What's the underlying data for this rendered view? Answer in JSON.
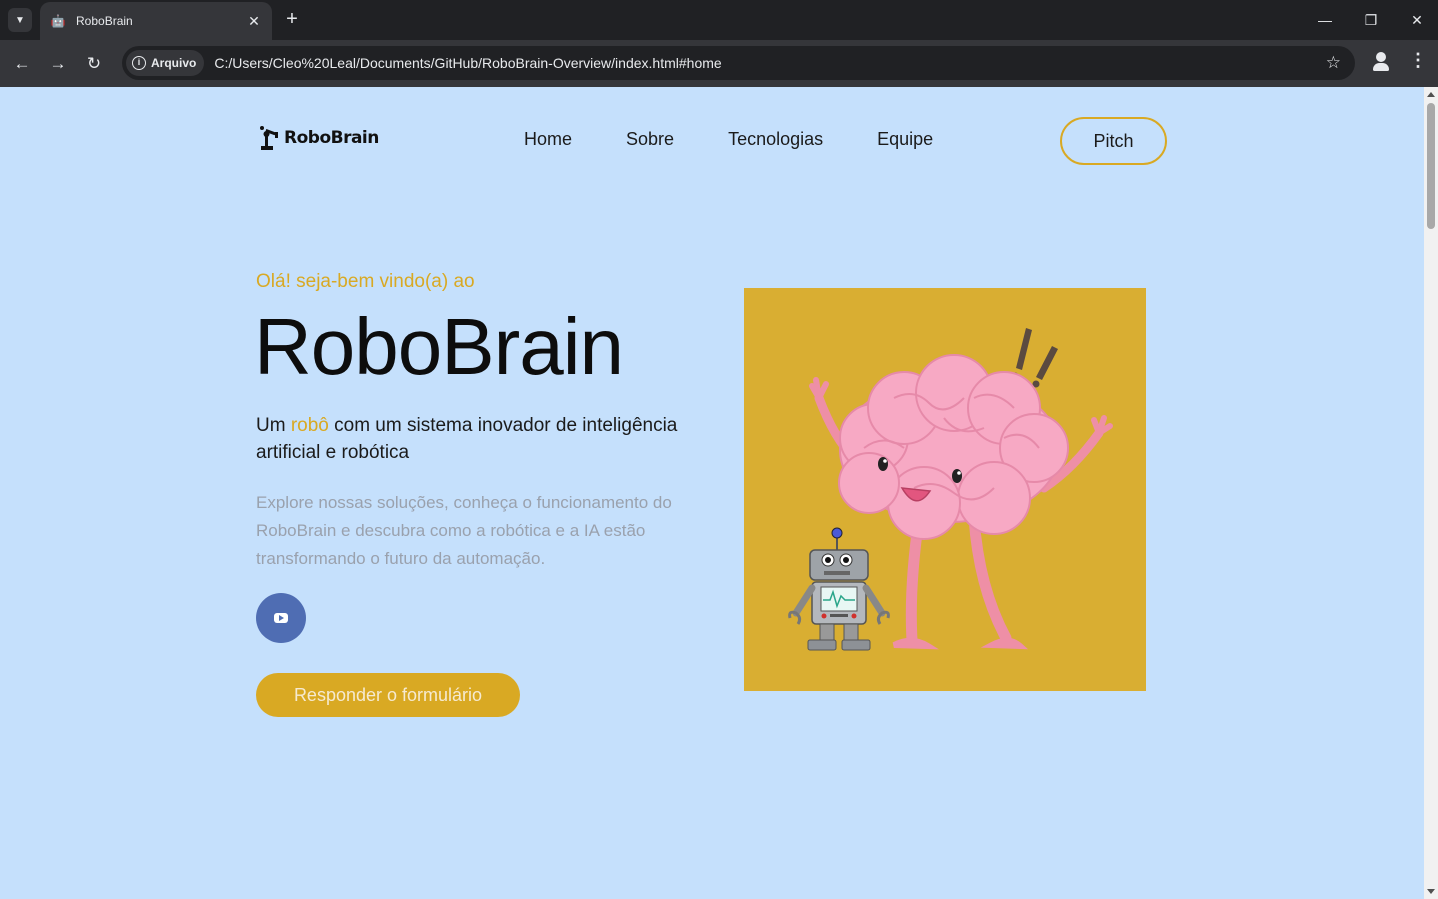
{
  "browser": {
    "tab_title": "RoboBrain",
    "url_chip": "Arquivo",
    "url": "C:/Users/Cleo%20Leal/Documents/GitHub/RoboBrain-Overview/index.html#home"
  },
  "page": {
    "brand": "RoboBrain",
    "nav": [
      "Home",
      "Sobre",
      "Tecnologias",
      "Equipe"
    ],
    "pitch_label": "Pitch",
    "greeting": "Olá! seja-bem vindo(a) ao",
    "title": "RoboBrain",
    "tagline_before": "Um ",
    "tagline_highlight": "robô",
    "tagline_after": " com um sistema inovador de inteligência artificial e robótica",
    "description": "Explore nossas soluções, conheça o funcionamento do RoboBrain e descubra como a robótica e a IA estão transformando o futuro da automação.",
    "cta_label": "Responder o formulário"
  },
  "colors": {
    "background": "#c5e0fc",
    "accent": "#d9a923",
    "youtube_button": "#4f6db3",
    "illustration_bg": "#d9ae32"
  }
}
